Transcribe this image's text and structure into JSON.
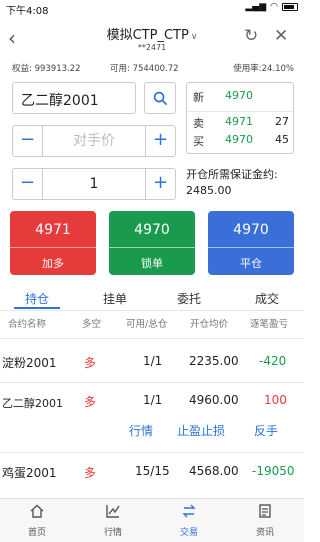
{
  "status_bar": {
    "time": "下午4:08",
    "signal": "▂▄▆",
    "wifi": "◠"
  },
  "header": {
    "title": "模拟CTP_CTP",
    "account": "**2471"
  },
  "account": {
    "equity_label": "权益:",
    "equity": "993913.22",
    "available_label": "可用:",
    "available": "754400.72",
    "usage_label": "使用率:",
    "usage": "24.10%"
  },
  "order_form": {
    "symbol": "乙二醇2001",
    "price_placeholder": "对手价",
    "quantity": "1",
    "minus": "−",
    "plus": "+"
  },
  "quote": {
    "latest_label": "新",
    "latest": "4970",
    "ask_label": "卖",
    "ask": "4971",
    "ask_volume": "27",
    "bid_label": "买",
    "bid": "4970",
    "bid_volume": "45"
  },
  "margin": {
    "label": "开仓所需保证金约:",
    "value": "2485.00"
  },
  "actions": {
    "buy": {
      "price": "4971",
      "label": "加多"
    },
    "lock": {
      "price": "4970",
      "label": "锁单"
    },
    "close": {
      "price": "4970",
      "label": "平仓"
    }
  },
  "tabs": [
    "持仓",
    "挂单",
    "委托",
    "成交"
  ],
  "table_headers": [
    "合约名称",
    "多空",
    "可用/总仓",
    "开仓均价",
    "逐笔盈亏"
  ],
  "positions": [
    {
      "name": "淀粉2001",
      "direction": "多",
      "available_total": "1/1",
      "avg_price": "2235.00",
      "pnl": "-420"
    },
    {
      "name": "乙二醇2001",
      "direction": "多",
      "available_total": "1/1",
      "avg_price": "4960.00",
      "pnl": "100"
    },
    {
      "name": "鸡蛋2001",
      "direction": "多",
      "available_total": "15/15",
      "avg_price": "4568.00",
      "pnl": "-19050"
    }
  ],
  "row_actions": [
    "行情",
    "止盈止损",
    "反手"
  ],
  "bottom_nav": [
    {
      "label": "首页",
      "icon": "home-icon"
    },
    {
      "label": "行情",
      "icon": "chart-icon"
    },
    {
      "label": "交易",
      "icon": "trade-icon"
    },
    {
      "label": "资讯",
      "icon": "news-icon"
    }
  ],
  "colors": {
    "accent": "#2d73d9",
    "up": "#e63b3b",
    "down": "#1a9a4c",
    "close": "#3a6fd8"
  }
}
